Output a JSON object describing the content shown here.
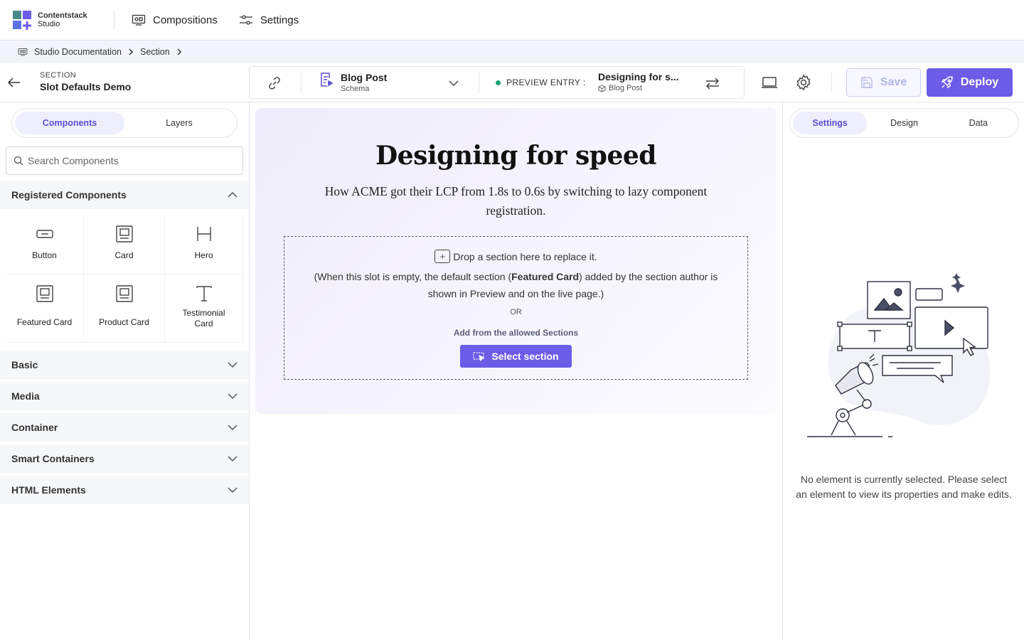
{
  "app": {
    "logo_name": "Contentstack",
    "logo_sub": "Studio",
    "brand_colors": [
      "#4b8a8c",
      "#6c5ce7",
      "#5b73e8",
      "#9aa8f0"
    ]
  },
  "nav": {
    "compositions": "Compositions",
    "settings": "Settings"
  },
  "breadcrumb": [
    "Studio Documentation",
    "Section"
  ],
  "header": {
    "section_label": "SECTION",
    "section_name": "Slot Defaults Demo",
    "schema_title": "Blog Post",
    "schema_sub": "Schema",
    "preview_label": "PREVIEW ENTRY :",
    "entry_title": "Designing for s...",
    "entry_type": "Blog Post",
    "save": "Save",
    "deploy": "Deploy",
    "accent": "#6c5ce7",
    "status_color": "#1aa36f"
  },
  "left": {
    "tabs": [
      "Components",
      "Layers"
    ],
    "active_tab": "Components",
    "search_placeholder": "Search Components",
    "registered_heading": "Registered Components",
    "components": [
      {
        "label": "Button",
        "icon": "button-icon"
      },
      {
        "label": "Card",
        "icon": "card-icon"
      },
      {
        "label": "Hero",
        "icon": "heading-icon"
      },
      {
        "label": "Featured Card",
        "icon": "card-icon"
      },
      {
        "label": "Product Card",
        "icon": "card-icon"
      },
      {
        "label": "Testimonial Card",
        "icon": "text-icon"
      }
    ],
    "groups": [
      "Basic",
      "Media",
      "Container",
      "Smart Containers",
      "HTML Elements"
    ]
  },
  "canvas": {
    "title": "Designing for speed",
    "subtitle": "How ACME got their LCP from 1.8s to 0.6s by switching to lazy component registration.",
    "drop_text": "Drop a section here to replace it.",
    "slot_note_pre": "(When this slot is empty, the default section (",
    "slot_note_bold": "Featured Card",
    "slot_note_post": ") added by the section author is shown in Preview and on the live page.)",
    "or": "OR",
    "allowed": "Add from the allowed Sections",
    "select_button": "Select section"
  },
  "right": {
    "tabs": [
      "Settings",
      "Design",
      "Data"
    ],
    "active_tab": "Settings",
    "empty_message": "No element is currently selected. Please select an element to view its properties and make edits."
  }
}
